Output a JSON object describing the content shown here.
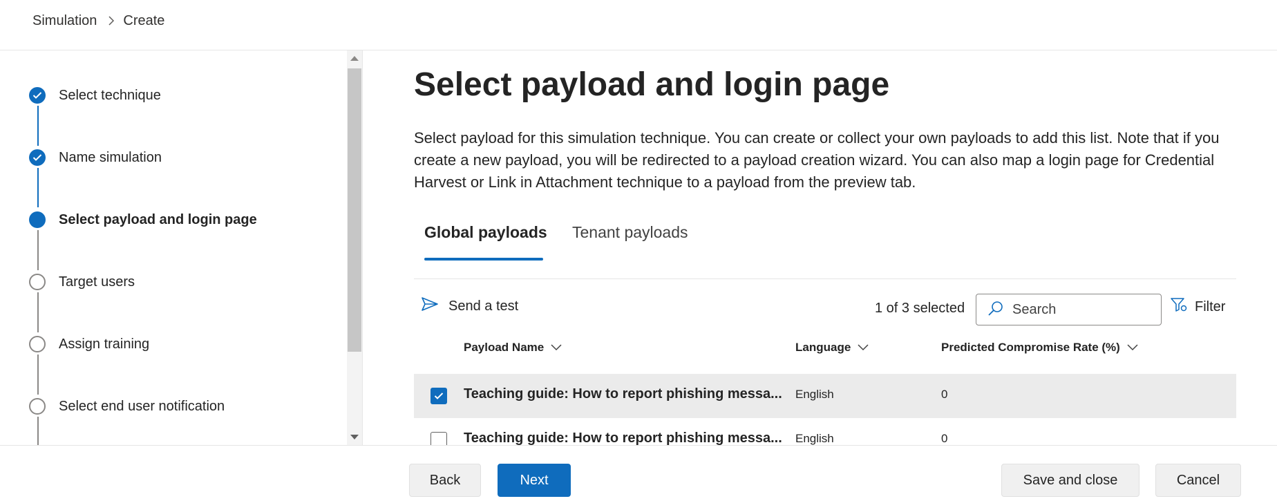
{
  "breadcrumb": {
    "root": "Simulation",
    "current": "Create"
  },
  "wizard": {
    "steps": [
      {
        "label": "Select technique",
        "state": "done"
      },
      {
        "label": "Name simulation",
        "state": "done"
      },
      {
        "label": "Select payload and login page",
        "state": "current"
      },
      {
        "label": "Target users",
        "state": "todo"
      },
      {
        "label": "Assign training",
        "state": "todo"
      },
      {
        "label": "Select end user notification",
        "state": "todo"
      }
    ]
  },
  "main": {
    "title": "Select payload and login page",
    "description": "Select payload for this simulation technique. You can create or collect your own payloads to add this list. Note that if you create a new payload, you will be redirected to a payload creation wizard. You can also map a login page for Credential Harvest or Link in Attachment technique to a payload from the preview tab.",
    "tabs": [
      {
        "label": "Global payloads",
        "active": true
      },
      {
        "label": "Tenant payloads",
        "active": false
      }
    ],
    "toolbar": {
      "send_test": "Send a test",
      "selected_count": "1 of 3 selected",
      "search_placeholder": "Search",
      "filter": "Filter"
    },
    "table": {
      "columns": [
        "Payload Name",
        "Language",
        "Predicted Compromise Rate (%)"
      ],
      "rows": [
        {
          "name": "Teaching guide: How to report phishing messa...",
          "language": "English",
          "rate": "0",
          "selected": true
        },
        {
          "name": "Teaching guide: How to report phishing messa...",
          "language": "English",
          "rate": "0",
          "selected": false
        }
      ]
    }
  },
  "footer": {
    "back": "Back",
    "next": "Next",
    "save_close": "Save and close",
    "cancel": "Cancel"
  },
  "colors": {
    "accent": "#0f6cbd",
    "selected_row": "#ebebeb",
    "pending_step": "#8a8886"
  }
}
